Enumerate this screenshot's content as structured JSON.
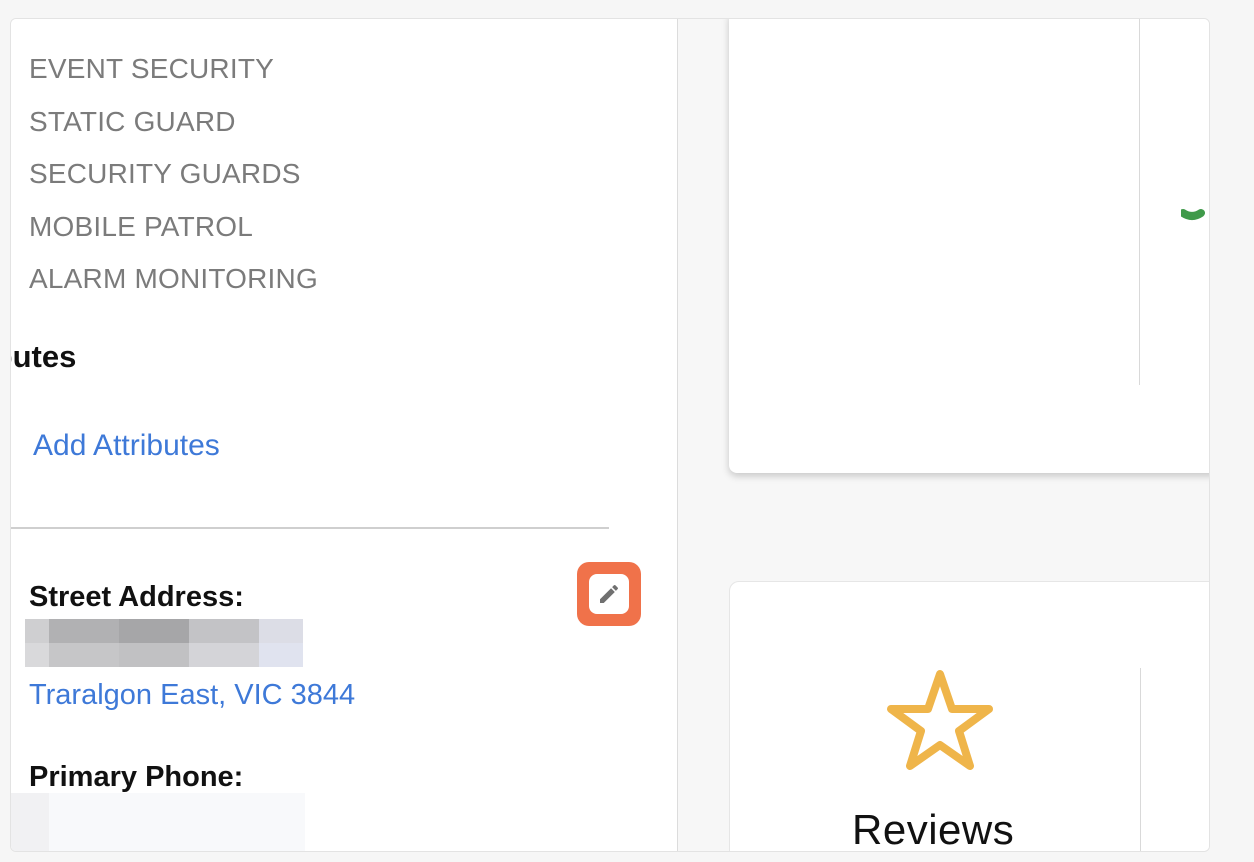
{
  "categories": [
    "EVENT SECURITY",
    "STATIC GUARD",
    "SECURITY GUARDS",
    "MOBILE PATROL",
    "ALARM MONITORING"
  ],
  "attributes": {
    "heading": "ributes",
    "add_link": "Add Attributes"
  },
  "address": {
    "label": "Street Address:",
    "city_line": "Traralgon East, VIC 3844"
  },
  "phone": {
    "label": "Primary Phone:"
  },
  "reviews": {
    "label": "Reviews"
  },
  "icons": {
    "edit": "pencil-icon",
    "review": "star-icon",
    "top_card_mark": "green-check-icon"
  },
  "colors": {
    "link": "#3e79d8",
    "edit_button": "#f0724a",
    "star": "#efb54a",
    "check": "#3f9a4a"
  }
}
